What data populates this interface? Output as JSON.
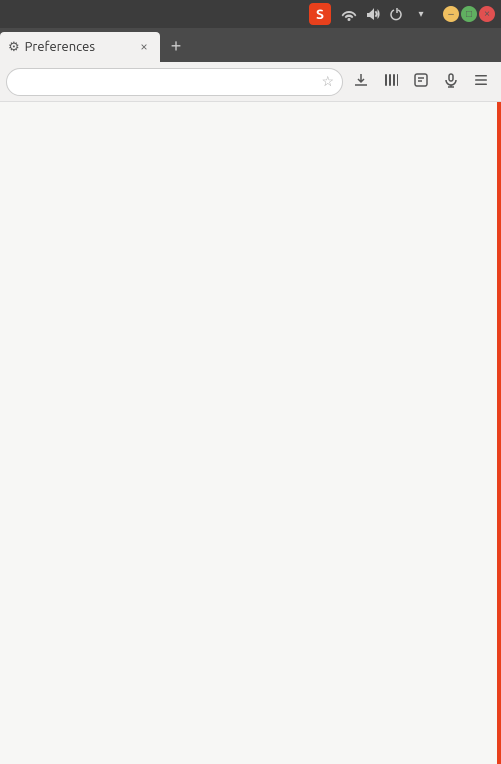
{
  "titlebar": {
    "logo_label": "S",
    "wifi_icon": "wifi-icon",
    "sound_icon": "sound-icon",
    "power_icon": "power-icon",
    "dropdown_icon": "dropdown-icon",
    "min_label": "–",
    "max_label": "□",
    "close_label": "×"
  },
  "tabbar": {
    "tab_icon": "⚙",
    "tab_label": "Preferences",
    "tab_close_label": "×",
    "new_tab_label": "+"
  },
  "navbar": {
    "bookmark_icon": "☆",
    "download_icon": "↓",
    "library_icon": "|||",
    "reader_icon": "□",
    "mic_icon": "🎤",
    "menu_icon": "≡",
    "address_placeholder": ""
  },
  "content": {
    "background": "#f7f7f5"
  }
}
